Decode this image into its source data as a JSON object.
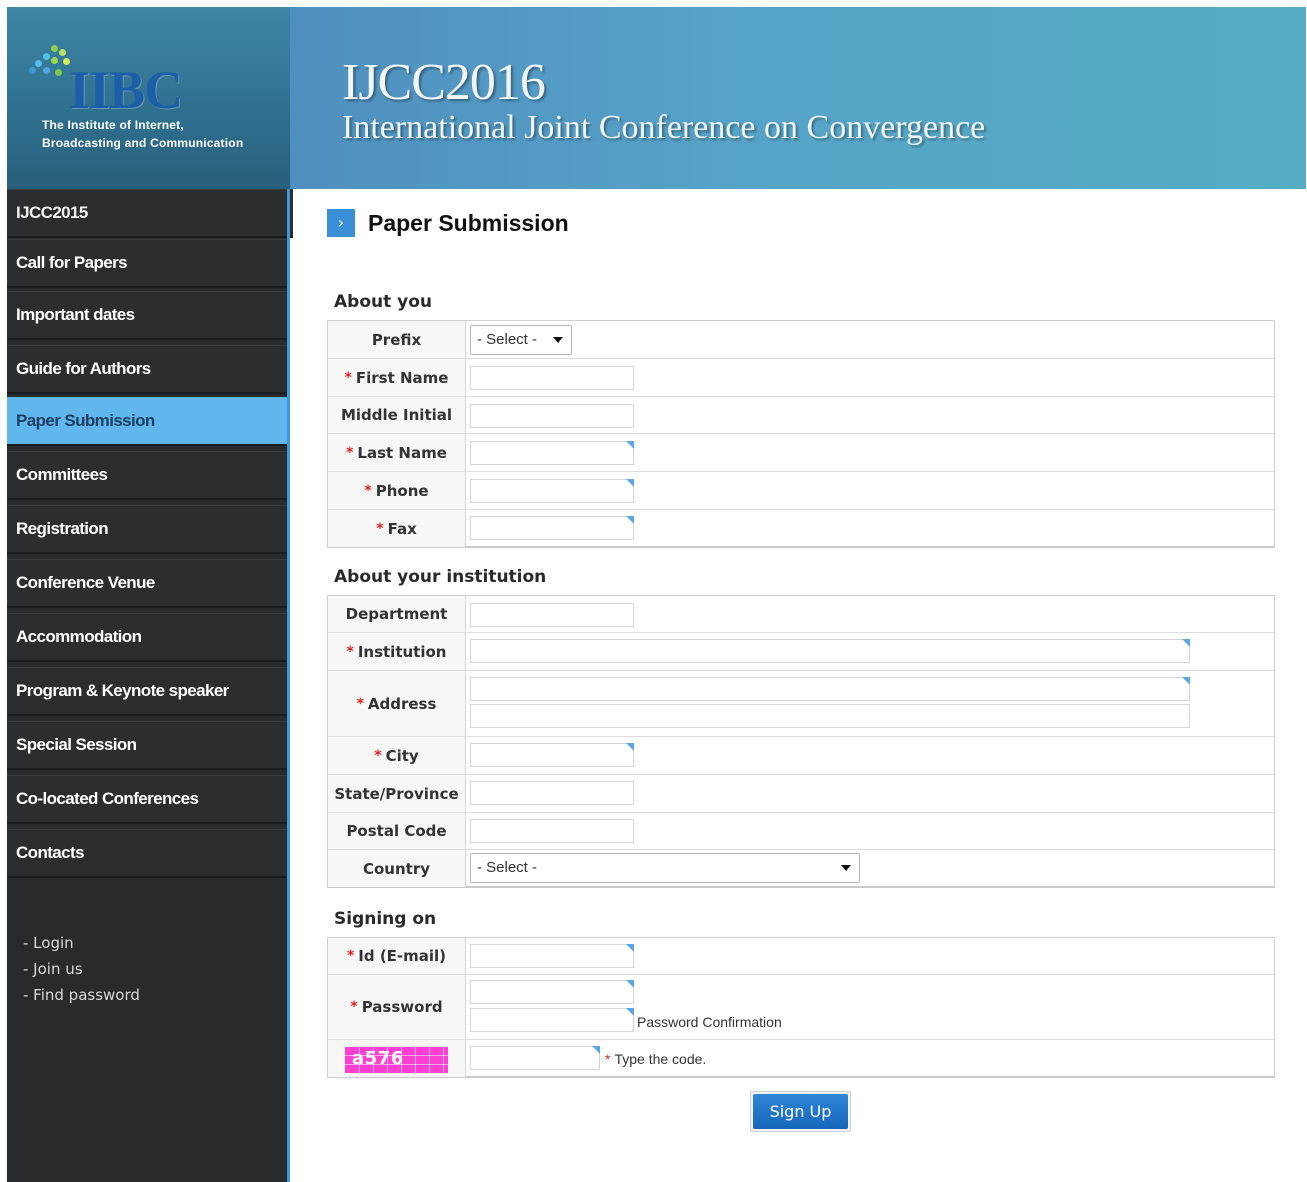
{
  "header": {
    "logo_text": "IIBC",
    "logo_subtitle_line1": "The Institute of Internet,",
    "logo_subtitle_line2": "Broadcasting and Communication",
    "banner_title": "IJCC2016",
    "banner_subtitle": "International Joint Conference on Convergence"
  },
  "sidebar": {
    "items": [
      {
        "label": "IJCC2015"
      },
      {
        "label": "Call for Papers"
      },
      {
        "label": "Important dates"
      },
      {
        "label": "Guide for Authors"
      },
      {
        "label": "Paper Submission",
        "active": true
      },
      {
        "label": "Committees"
      },
      {
        "label": "Registration"
      },
      {
        "label": "Conference Venue"
      },
      {
        "label": "Accommodation"
      },
      {
        "label": "Program & Keynote speaker"
      },
      {
        "label": "Special Session"
      },
      {
        "label": "Co-located Conferences"
      },
      {
        "label": "Contacts"
      }
    ],
    "links": [
      "- Login",
      "- Join us",
      "- Find password"
    ]
  },
  "page": {
    "title_icon": "chevron-right-icon",
    "title": "Paper Submission"
  },
  "form": {
    "about_you": {
      "title": "About you",
      "prefix_label": "Prefix",
      "prefix_value": "- Select -",
      "first_name_label": "First Name",
      "middle_initial_label": "Middle Initial",
      "last_name_label": "Last Name",
      "phone_label": "Phone",
      "fax_label": "Fax"
    },
    "institution": {
      "title": "About your institution",
      "department_label": "Department",
      "institution_label": "Institution",
      "address_label": "Address",
      "city_label": "City",
      "state_label": "State/Province",
      "postal_label": "Postal Code",
      "country_label": "Country",
      "country_value": "- Select -"
    },
    "signing_on": {
      "title": "Signing on",
      "id_label": "Id (E-mail)",
      "password_label": "Password",
      "password_confirmation_label": "Password Confirmation",
      "captcha_text": "a576",
      "type_code_label": "Type the code."
    },
    "required_marker": "*",
    "submit_label": "Sign Up"
  },
  "colors": {
    "accent": "#3b98d8",
    "active_nav": "#5fb7ee",
    "sidebar_bg": "#282a2b",
    "required": "#e0201c",
    "captcha_bg": "#ff3fd2",
    "button": "#1d74c8"
  }
}
